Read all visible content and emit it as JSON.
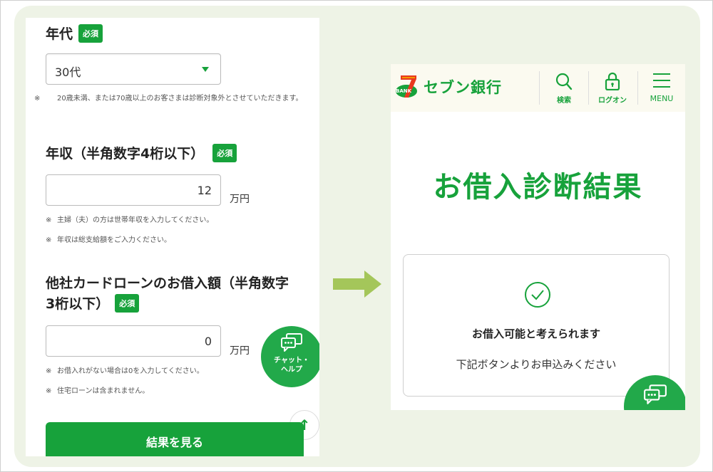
{
  "left_form": {
    "age": {
      "label": "年代",
      "required_badge": "必須",
      "selected_value": "30代",
      "note": "20歳未満、または70歳以上のお客さまは診断対象外とさせていただきます。"
    },
    "income": {
      "label": "年収（半角数字4桁以下）",
      "required_badge": "必須",
      "value": "12",
      "unit": "万円",
      "notes": [
        "主婦（夫）の方は世帯年収を入力してください。",
        "年収は総支給額をご入力ください。"
      ]
    },
    "other_loans": {
      "label_line1": "他社カードローンのお借入額（半角数字",
      "label_line2": "3桁以下）",
      "required_badge": "必須",
      "value": "0",
      "unit": "万円",
      "notes": [
        "お借入れがない場合は0を入力してください。",
        "住宅ローンは含まれません。"
      ]
    },
    "note_mark": "※",
    "chat_label_line1": "チャット・",
    "chat_label_line2": "ヘルプ",
    "scroll_top_icon": "↑",
    "submit_label": "結果を見る"
  },
  "right_result": {
    "logo_badge": "BANK",
    "logo_number": "7",
    "logo_text": "セブン銀行",
    "nav": {
      "search_label": "検索",
      "logon_label": "ログオン",
      "menu_label": "MENU"
    },
    "title": "お借入診断結果",
    "result_heading": "お借入可能と考えられます",
    "result_sub": "下記ボタンよりお申込みください"
  },
  "colors": {
    "brand_green": "#17a23b",
    "arrow_green": "#a4c65a",
    "panel_bg": "#eef3e6"
  }
}
